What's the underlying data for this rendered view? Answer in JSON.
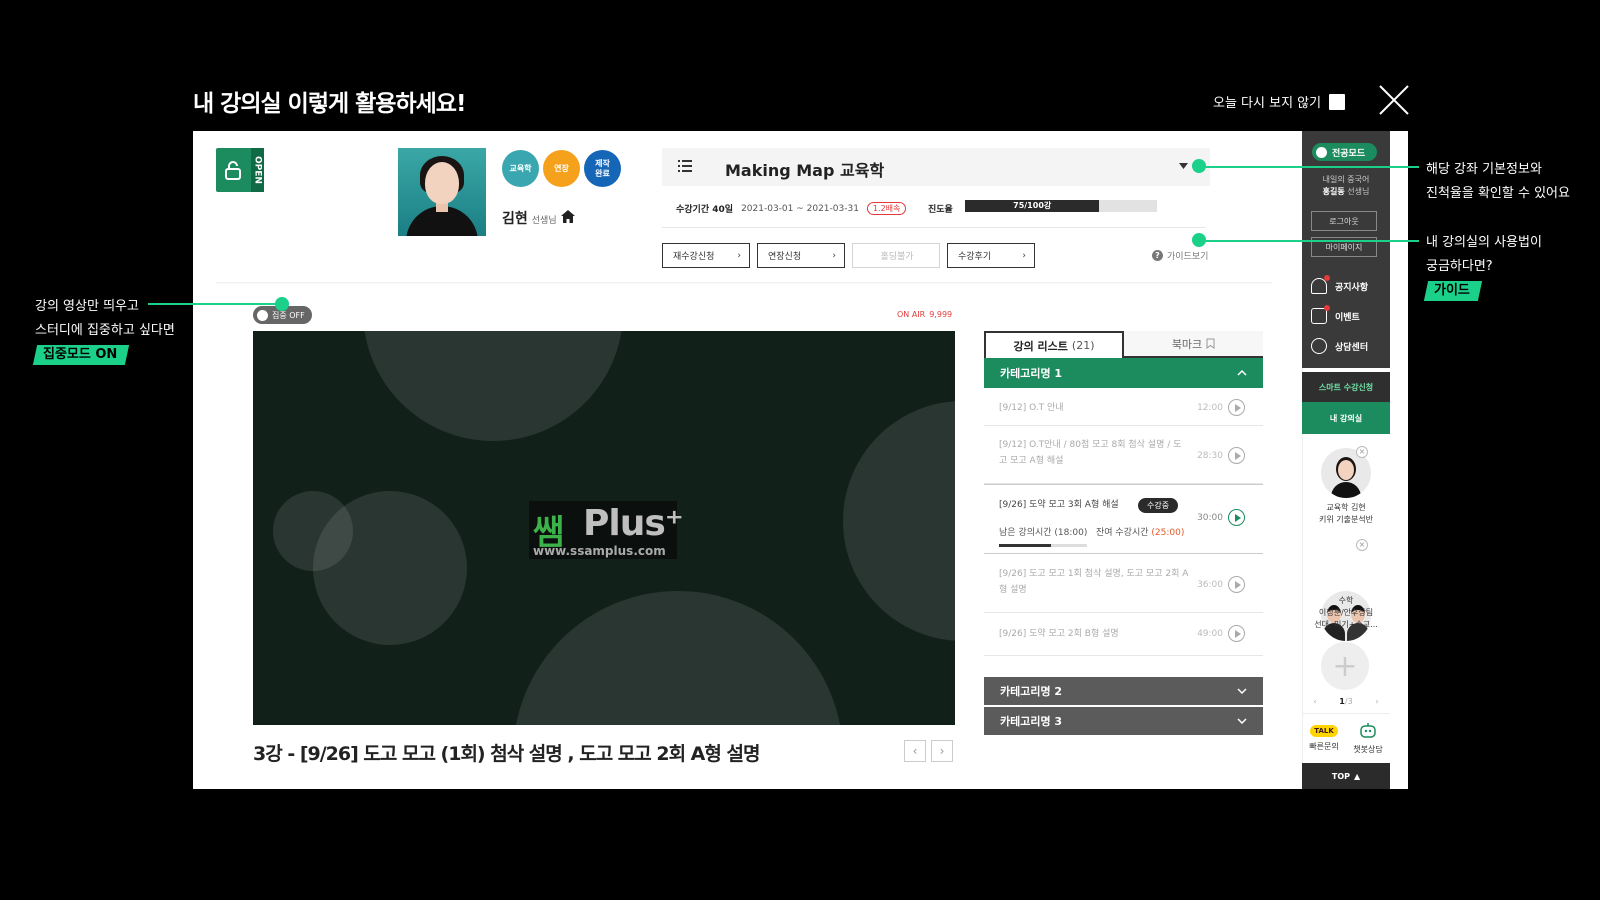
{
  "overlay": {
    "title": "내 강의실 이렇게 활용하세요!",
    "dont_show_today": "오늘 다시 보지 않기"
  },
  "annotations": {
    "left": {
      "line1": "강의 영상만 띄우고",
      "line2": "스터디에 집중하고 싶다면",
      "tag": "집중모드 ON"
    },
    "right_top": {
      "line1": "해당 강좌 기본정보와",
      "line2": "진척율을 확인할 수 있어요"
    },
    "right_mid": {
      "line1": "내 강의실의 사용법이",
      "line2": "궁금하다면?",
      "tag": "가이드"
    }
  },
  "course": {
    "open_badge": "OPEN",
    "category_badges": [
      {
        "label": "교육학",
        "color": "#3aa7b0"
      },
      {
        "label": "연장",
        "color": "#f5a11b"
      },
      {
        "label": "제작\n완료",
        "color": "#1666b8"
      }
    ],
    "professor": "김현",
    "professor_suffix": "선생님",
    "title": "Making Map 교육학",
    "period_label": "수강기간 40일",
    "period_dates": "2021-03-01 ~ 2021-03-31",
    "speed_badge": "1.2배속",
    "progress_label": "진도율",
    "progress_text": "75/100강",
    "progress_fraction": 0.7,
    "buttons": {
      "retake": "재수강신청",
      "extend": "연장신청",
      "hold": "홀딩불가",
      "review": "수강후기"
    },
    "guide_link": "가이드보기"
  },
  "player": {
    "focus_toggle": "집중 OFF",
    "onair_label": "ON AIR",
    "onair_count": "9,999",
    "logo_ssam": "쌤",
    "logo_plus": "Plus⁺",
    "logo_url": "www.ssamplus.com",
    "lecture_title": "3강 - [9/26] 도고 모고 (1회) 첨삭 설명 , 도고 모고 2회 A형 설명"
  },
  "lecture_list": {
    "tab_list": "강의 리스트",
    "tab_list_count": "(21)",
    "tab_bookmark": "북마크",
    "open_category": "카테고리명 1",
    "items": [
      {
        "title": "[9/12] O.T 안내",
        "time": "12:00"
      },
      {
        "title": "[9/12] O.T안내 / 80점 모고 8회 첨삭 설명 / 도고 모고 A형 해설",
        "time": "28:30"
      },
      {
        "title": "[9/26] 도약 모고 3회 A형 해설",
        "time": "30:00",
        "status": "수강중",
        "remain_label": "남은 강의시간 (18:00)",
        "remain_extra": "잔여 수강시간",
        "remain_extra_value": "(25:00)"
      },
      {
        "title": "[9/26] 도고 모고 1회 첨삭 설명, 도고 모고 2회 A형 설명",
        "time": "36:00"
      },
      {
        "title": "[9/26] 도약 모고 2회 B형 설명",
        "time": "49:00"
      }
    ],
    "closed_categories": [
      "카테고리명 2",
      "카테고리명 3"
    ]
  },
  "sidebar": {
    "mode": "전공모드",
    "user_line1": "내일의 중국어",
    "user_name": "홍길동",
    "user_suffix": " 선생님",
    "logout": "로그아웃",
    "mypage": "마이페이지",
    "links": [
      "공지사항",
      "이벤트",
      "상담센터"
    ],
    "smart_apply": "스마트 수강신청",
    "my_room": "내 강의실",
    "recent": [
      {
        "line1": "교육학 김현",
        "line2": "키위 기출분석반"
      },
      {
        "line1": "수학",
        "line2": "이정훈/안후상팀",
        "line3": "선대, 미기+수교..."
      }
    ],
    "pager_current": "1",
    "pager_total": "/3",
    "quick_ask": "빠른문의",
    "chatbot": "챗봇상담",
    "talk": "TALK",
    "top": "TOP"
  }
}
